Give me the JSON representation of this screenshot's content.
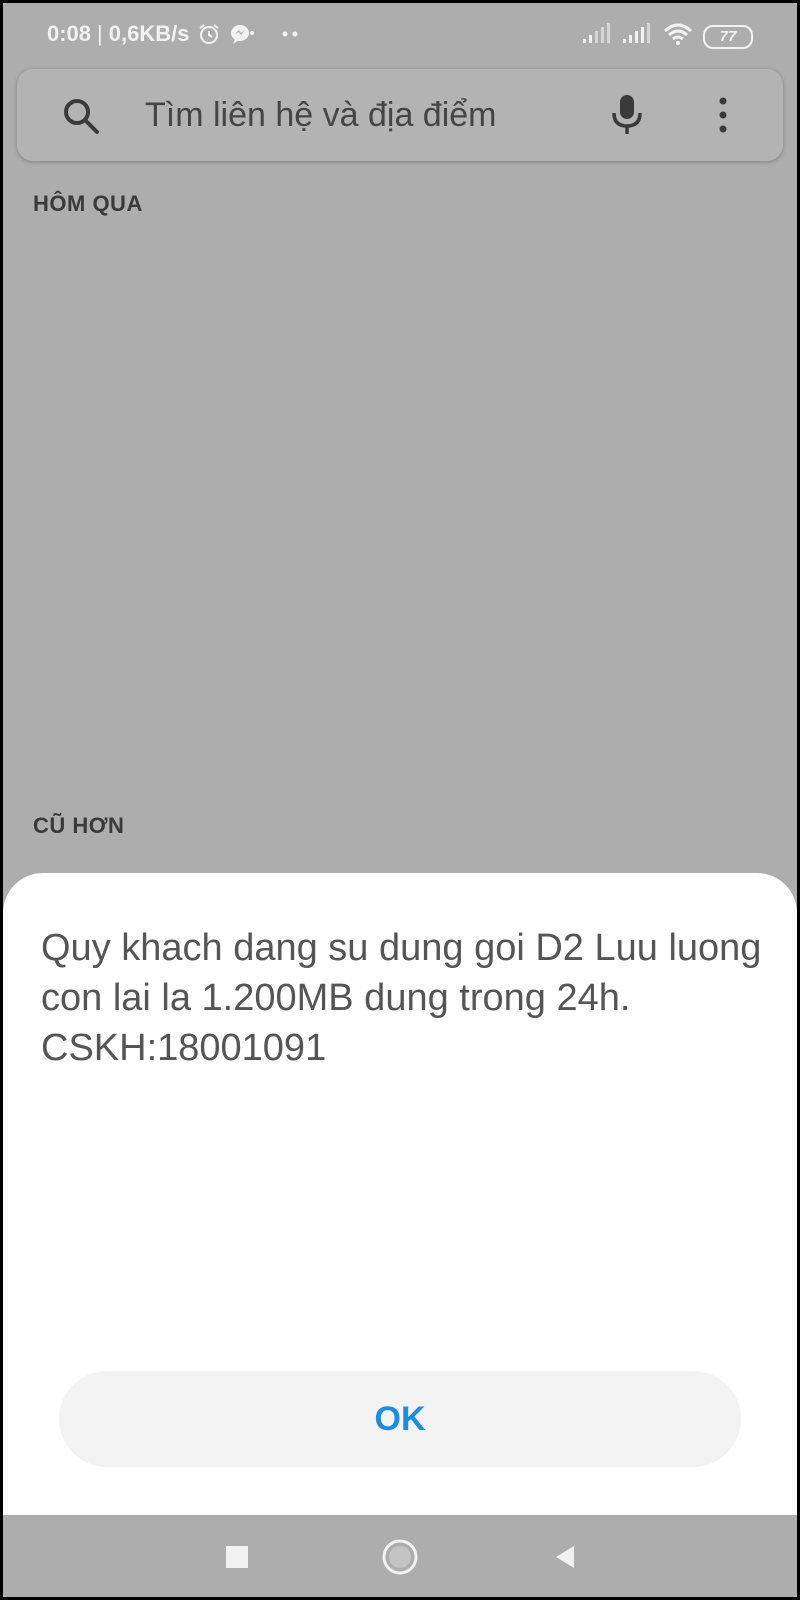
{
  "status_bar": {
    "time": "0:08",
    "separator": "|",
    "network_speed": "0,6KB/s",
    "battery_level": "77",
    "icons": [
      "alarm-icon",
      "messenger-icon",
      "more-notifications-icon",
      "signal-icon",
      "signal-icon",
      "wifi-icon",
      "battery-icon"
    ]
  },
  "search": {
    "placeholder": "Tìm liên hệ và địa điểm",
    "value": "",
    "icons": [
      "search-icon",
      "mic-icon",
      "more-vert-icon"
    ]
  },
  "sections": {
    "yesterday": "HÔM QUA",
    "older": "CŨ HƠN"
  },
  "dialog": {
    "message": "Quy khach dang su dung goi D2 Luu luong con lai la 1.200MB dung trong 24h. CSKH:18001091",
    "ok_label": "OK"
  },
  "nav_bar": {
    "icons": [
      "recents-icon",
      "home-icon",
      "back-icon"
    ]
  },
  "colors": {
    "overlay_background": "#adadad",
    "dialog_background": "#ffffff",
    "ok_text": "#1f8ce0",
    "message_text": "#555555"
  }
}
